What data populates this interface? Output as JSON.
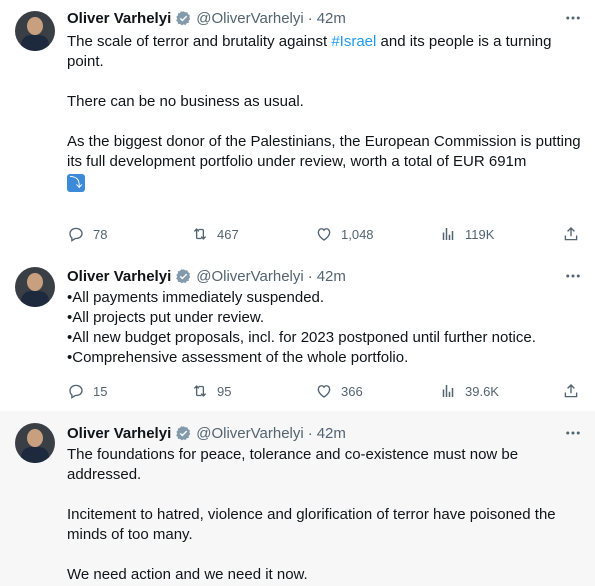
{
  "author": {
    "name": "Oliver Varhelyi",
    "handle": "@OliverVarhelyi",
    "dot": "·",
    "time": "42m"
  },
  "tweets": [
    {
      "paragraphs": [
        {
          "before": "The scale of terror and brutality against ",
          "hashtag": "#Israel",
          "after": " and its people is a turning point."
        },
        {
          "text": "There can be no business as usual."
        },
        {
          "text": "As the biggest donor of the Palestinians, the European Commission is putting its full development portfolio under review, worth a total of EUR 691m"
        }
      ],
      "emoji": "⤵",
      "stats": {
        "replies": "78",
        "reposts": "467",
        "likes": "1,048",
        "views": "119K"
      }
    },
    {
      "lines": [
        "•All payments immediately suspended.",
        "•All projects put under review.",
        "•All new budget proposals, incl. for 2023 postponed until further notice.",
        "•Comprehensive assessment of the whole portfolio."
      ],
      "stats": {
        "replies": "15",
        "reposts": "95",
        "likes": "366",
        "views": "39.6K"
      }
    },
    {
      "paragraphs": [
        "The foundations for peace, tolerance and co-existence must now be addressed.",
        "Incitement to hatred, violence and glorification of terror have poisoned the minds of too many.",
        "We need action and we need it now."
      ]
    }
  ],
  "icons": [
    "reply-icon",
    "repost-icon",
    "like-icon",
    "views-icon",
    "share-icon",
    "more-icon",
    "verified-icon"
  ],
  "colors": {
    "link": "#1d9bf0",
    "muted": "#536471",
    "verified": "#829aab",
    "thread_line": "#cfd9de",
    "highlight_bg": "#f7f7f7"
  }
}
